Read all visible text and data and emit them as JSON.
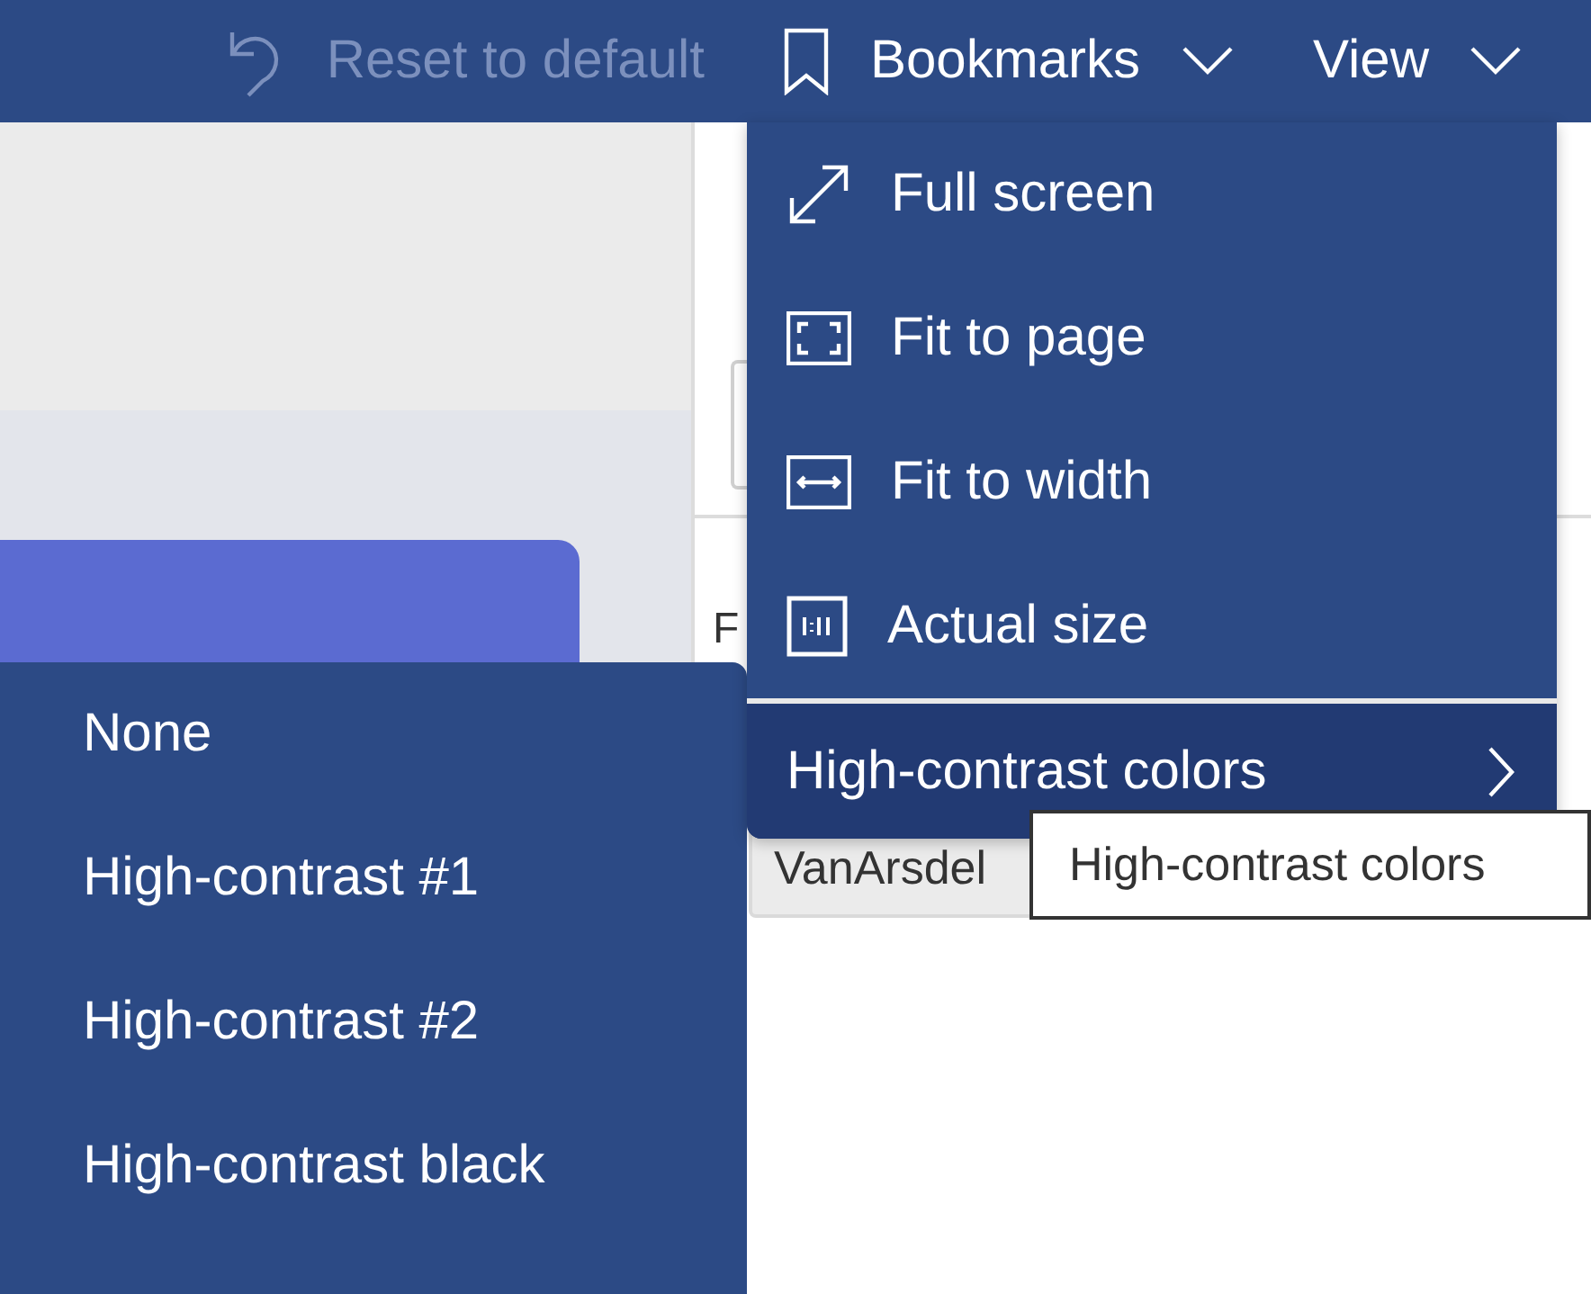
{
  "toolbar": {
    "items": [
      {
        "kind": "reset",
        "label": "Reset to default",
        "disabled": true
      },
      {
        "kind": "bookmarks",
        "label": "Bookmarks",
        "disabled": false
      },
      {
        "kind": "view",
        "label": "View",
        "disabled": false
      }
    ]
  },
  "canvas": {
    "field_label": "F",
    "card_text": "VanArsdel"
  },
  "view_menu": {
    "items": [
      {
        "kind": "full-screen",
        "label": "Full screen",
        "selected": false
      },
      {
        "kind": "fit-page",
        "label": "Fit to page",
        "selected": false
      },
      {
        "kind": "fit-width",
        "label": "Fit to width",
        "selected": false
      },
      {
        "kind": "actual-size",
        "label": "Actual size",
        "selected": false
      },
      {
        "kind": "submenu",
        "label": "High-contrast colors",
        "selected": true
      }
    ]
  },
  "contrast_menu": {
    "items": [
      {
        "label": "None"
      },
      {
        "label": "High-contrast #1"
      },
      {
        "label": "High-contrast #2"
      },
      {
        "label": "High-contrast black"
      }
    ]
  },
  "tooltip": {
    "text": "High-contrast colors"
  }
}
